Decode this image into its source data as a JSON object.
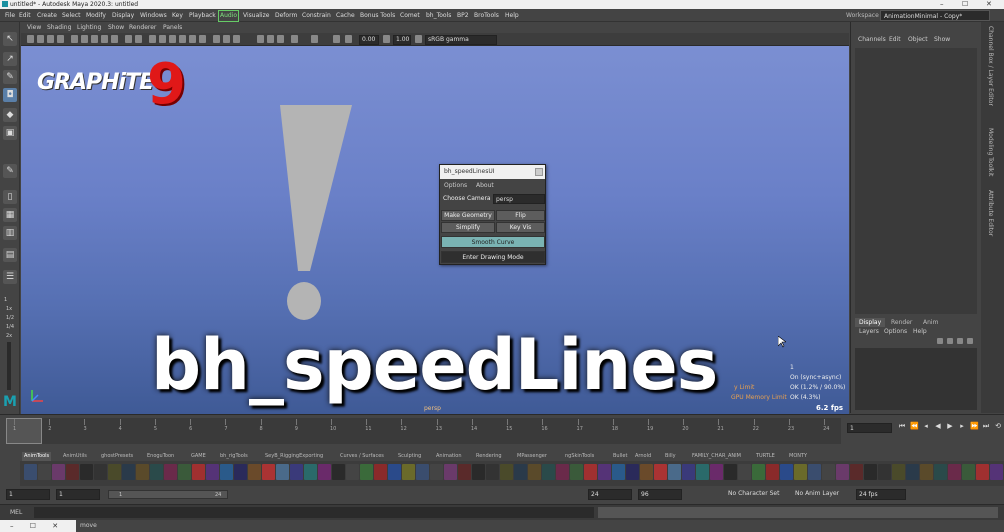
{
  "title_bar": {
    "title": "untitled* - Autodesk Maya 2020.3: untitled",
    "min": "–",
    "max": "☐",
    "close": "✕"
  },
  "menu": [
    "File",
    "Edit",
    "Create",
    "Select",
    "Modify",
    "Display",
    "Windows",
    "Key",
    "Playback",
    "Audio",
    "Visualize",
    "Deform",
    "Constrain",
    "Cache",
    "Bonus Tools",
    "Comet",
    "bh_Tools",
    "BP2",
    "BroTools",
    "Help"
  ],
  "workspace": {
    "label": "Workspace :",
    "value": "AnimationMinimal - Copy*"
  },
  "panel_menu": [
    "View",
    "Shading",
    "Lighting",
    "Show",
    "Renderer",
    "Panels"
  ],
  "viewport_fields": {
    "exposure": "0.00",
    "gamma": "1.00",
    "colorspace": "sRGB gamma"
  },
  "logo": {
    "text": "GRAPHiTE",
    "nine": "9"
  },
  "big_title": "bh_speedLines",
  "exclaim": "!",
  "dialog": {
    "title": "bh_speedLinesUI",
    "menus": [
      "Options",
      "About"
    ],
    "camera_label": "Choose Camera >",
    "camera_value": "persp",
    "make_geometry": "Make Geometry",
    "flip": "Flip",
    "simplify": "Simplify",
    "key_vis": "Key Vis",
    "smooth_curve": "Smooth Curve",
    "enter_drawing": "Enter Drawing Mode"
  },
  "hud": {
    "l1": "1",
    "l2": "On (sync+async)",
    "l3_label": "y Limit",
    "l3": "OK (1.2% / 90.0%)",
    "l4_label": "GPU Memory Limit",
    "l4": "OK (4.3%)",
    "fps": "6.2 fps",
    "camera": "persp"
  },
  "channel_box": {
    "menus": [
      "Channels",
      "Edit",
      "Object",
      "Show"
    ]
  },
  "layer_editor": {
    "tabs": [
      "Display",
      "Render",
      "Anim"
    ],
    "menus": [
      "Layers",
      "Options",
      "Help"
    ]
  },
  "side_tabs": [
    "Channel Box / Layer Editor",
    "Modeling Toolkit",
    "Attribute Editor"
  ],
  "timeline": {
    "ticks": [
      "1",
      "2",
      "3",
      "4",
      "5",
      "6",
      "7",
      "8",
      "9",
      "10",
      "11",
      "12",
      "13",
      "14",
      "15",
      "16",
      "17",
      "18",
      "19",
      "20",
      "21",
      "22",
      "23",
      "24"
    ],
    "current": "1"
  },
  "shelf_tabs": [
    "AnimTools",
    "AnimUtils",
    "ghostPresets",
    "EnoguToon",
    "GAME",
    "bh_rigTools",
    "SeyB_RiggingExporting",
    "Curves / Surfaces",
    "Sculpting",
    "Animation",
    "Rendering",
    "MPassenger",
    "ngSkinTools",
    "Bullet",
    "Arnold",
    "Billy",
    "FAMILY_CHAR_ANIM",
    "TURTLE",
    "MONTY"
  ],
  "range": {
    "start": "1",
    "start2": "1",
    "slider_start": "1",
    "slider_end": "24",
    "end1": "24",
    "end2": "96",
    "character_set": "No Character Set",
    "anim_layer": "No Anim Layer",
    "fps": "24 fps"
  },
  "mel": {
    "label": "MEL"
  },
  "help_line": "move",
  "left_tools": {
    "lbl1": "1",
    "lbl2": "1x",
    "lbl3": "1/2",
    "lbl4": "1/4",
    "lbl5": "2x"
  }
}
